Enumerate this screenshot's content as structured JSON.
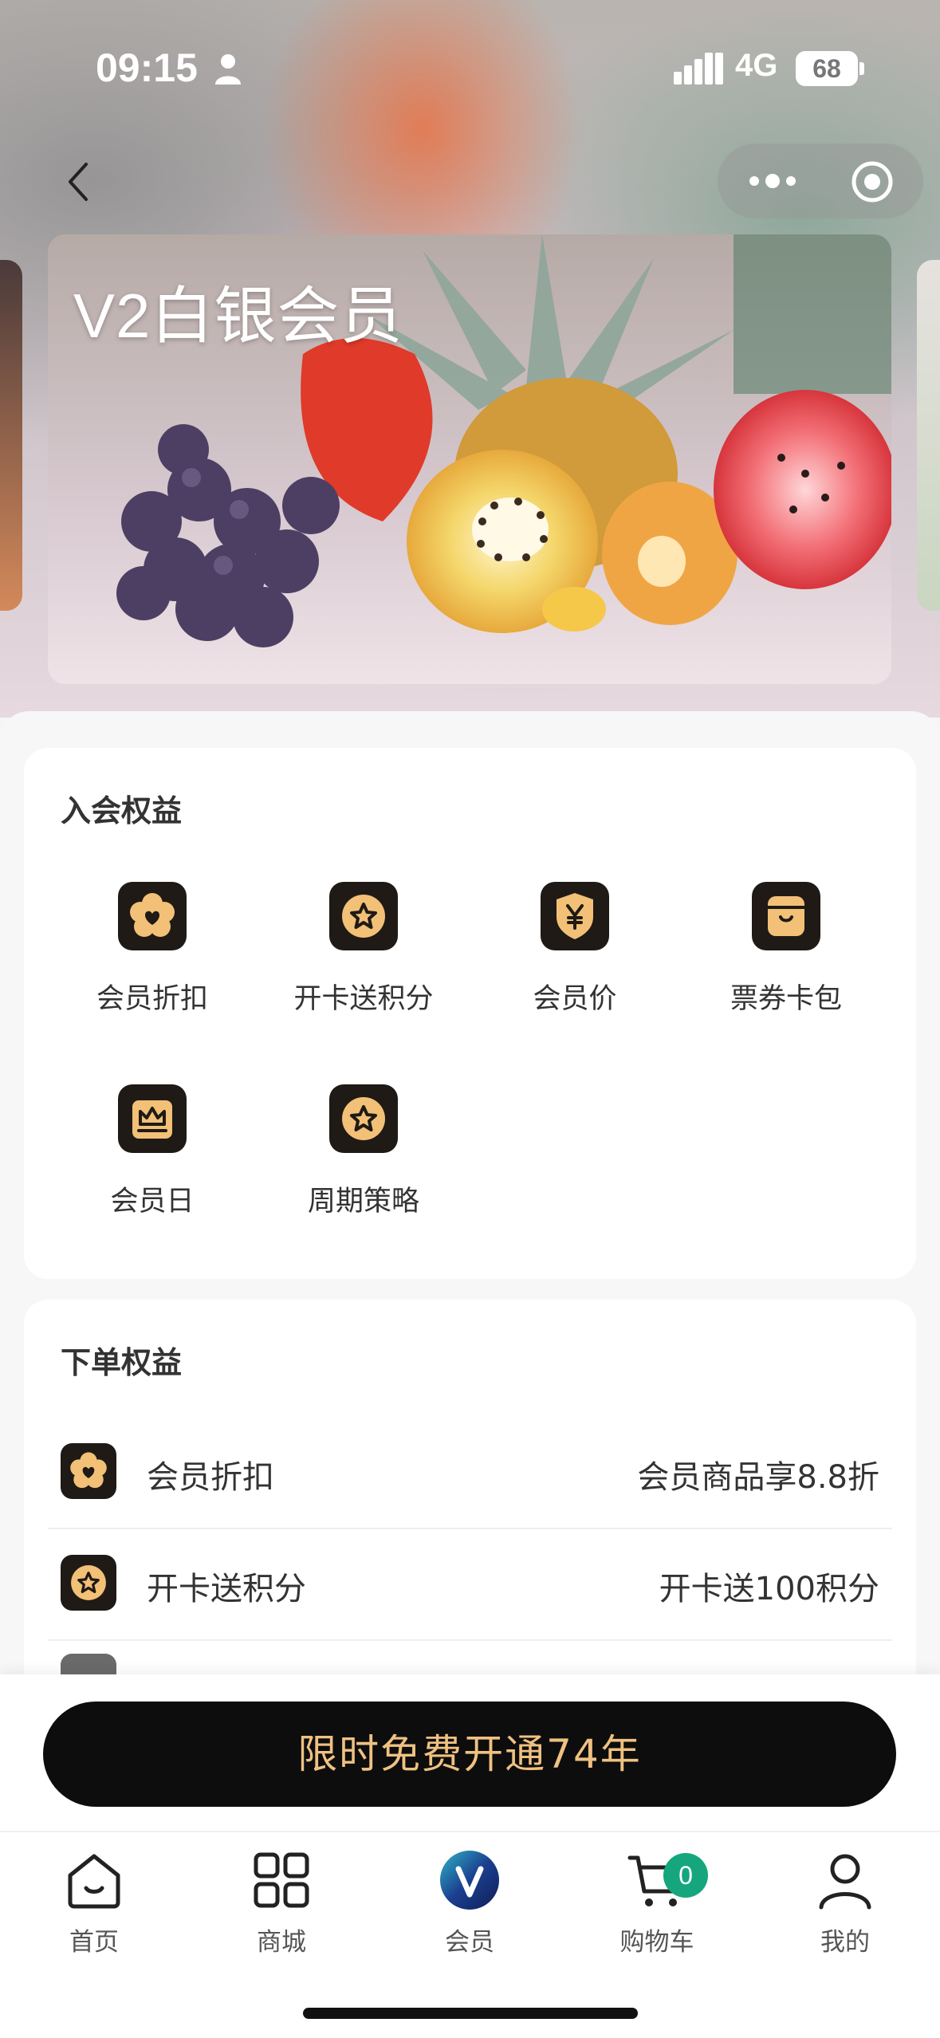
{
  "status_bar": {
    "time": "09:15",
    "network": "4G",
    "battery": "68"
  },
  "card": {
    "title": "V2白银会员"
  },
  "join_benefits": {
    "title": "入会权益",
    "items": [
      {
        "label": "会员折扣",
        "icon": "flower-heart-icon"
      },
      {
        "label": "开卡送积分",
        "icon": "star-badge-icon"
      },
      {
        "label": "会员价",
        "icon": "yen-shield-icon"
      },
      {
        "label": "票券卡包",
        "icon": "wallet-icon"
      },
      {
        "label": "会员日",
        "icon": "crown-icon"
      },
      {
        "label": "周期策略",
        "icon": "star-badge-icon"
      }
    ]
  },
  "order_benefits": {
    "title": "下单权益",
    "rows": [
      {
        "name": "会员折扣",
        "desc": "会员商品享8.8折",
        "icon": "flower-heart-icon"
      },
      {
        "name": "开卡送积分",
        "desc": "开卡送100积分",
        "icon": "star-badge-icon"
      }
    ]
  },
  "cta": {
    "label": "限时免费开通74年"
  },
  "tabbar": {
    "items": [
      {
        "label": "首页",
        "icon": "home-icon"
      },
      {
        "label": "商城",
        "icon": "grid-icon"
      },
      {
        "label": "会员",
        "icon": "vip-logo-icon"
      },
      {
        "label": "购物车",
        "icon": "cart-icon"
      },
      {
        "label": "我的",
        "icon": "user-icon"
      }
    ],
    "cart_count": "0"
  },
  "colors": {
    "icon_bg": "#1f1a15",
    "icon_fg": "#f2c077",
    "cta_bg": "#0d0d0d",
    "cta_text": "#efc181",
    "badge": "#15a67d"
  }
}
